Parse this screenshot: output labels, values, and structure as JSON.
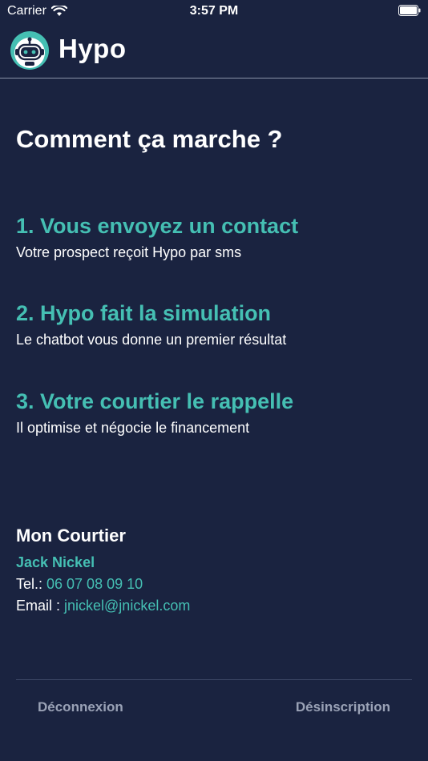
{
  "status_bar": {
    "carrier": "Carrier",
    "time": "3:57 PM"
  },
  "header": {
    "title": "Hypo",
    "logo_icon": "robot-avatar-icon"
  },
  "main": {
    "title": "Comment ça marche ?",
    "steps": [
      {
        "title": "1. Vous envoyez un contact",
        "description": "Votre prospect reçoit Hypo par sms"
      },
      {
        "title": "2. Hypo fait la simulation",
        "description": "Le chatbot vous donne un premier résultat"
      },
      {
        "title": "3. Votre courtier le rappelle",
        "description": "Il optimise et négocie le financement"
      }
    ]
  },
  "broker": {
    "heading": "Mon Courtier",
    "name": "Jack Nickel",
    "tel_label": "Tel.: ",
    "tel_value": "06 07 08 09 10",
    "email_label": "Email : ",
    "email_value": "jnickel@jnickel.com"
  },
  "footer": {
    "logout_label": "Déconnexion",
    "unsubscribe_label": "Désinscription"
  },
  "colors": {
    "background": "#1a2340",
    "accent": "#45bfb3",
    "muted": "#9aa2b6"
  }
}
